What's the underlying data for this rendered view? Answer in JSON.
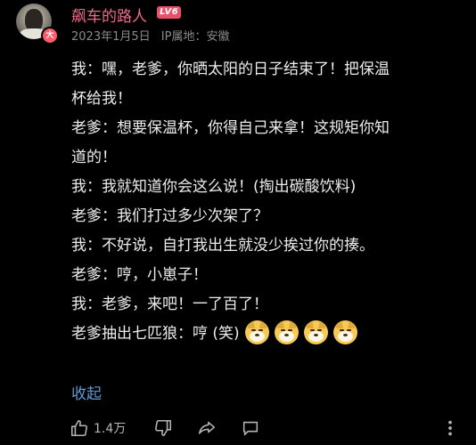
{
  "post": {
    "author": {
      "name": "飙车的路人",
      "level": "LV6",
      "avatar_badge": "大"
    },
    "date": "2023年1月5日",
    "ip_location": "IP属地：安徽",
    "lines": [
      "我：嘿，老爹，你晒太阳的日子结束了！把保温",
      "杯给我！",
      "老爹：想要保温杯，你得自己来拿！这规矩你知",
      "道的！",
      "我：我就知道你会这么说！(掏出碳酸饮料)",
      "老爹：我们打过多少次架了？",
      "我：不好说，自打我出生就没少挨过你的揍。",
      "老爹：哼，小崽子！",
      "我：老爹，来吧！一了百了！",
      "老爹抽出七匹狼：哼 (笑)"
    ],
    "emojis": [
      "doge-emoji",
      "doge-emoji",
      "doge-emoji",
      "doge-emoji"
    ],
    "collapse_label": "收起"
  },
  "actions": {
    "like_count": "1.4万",
    "icons": {
      "like": "thumbs-up-icon",
      "dislike": "thumbs-down-icon",
      "share": "share-icon",
      "comment": "comment-icon",
      "more": "more-vertical-icon"
    }
  },
  "colors": {
    "background": "#000000",
    "username": "#f06a8a",
    "level_badge": "#e9506c",
    "link": "#5d9bd6",
    "text": "#ececec",
    "meta": "#8a8a8a"
  }
}
